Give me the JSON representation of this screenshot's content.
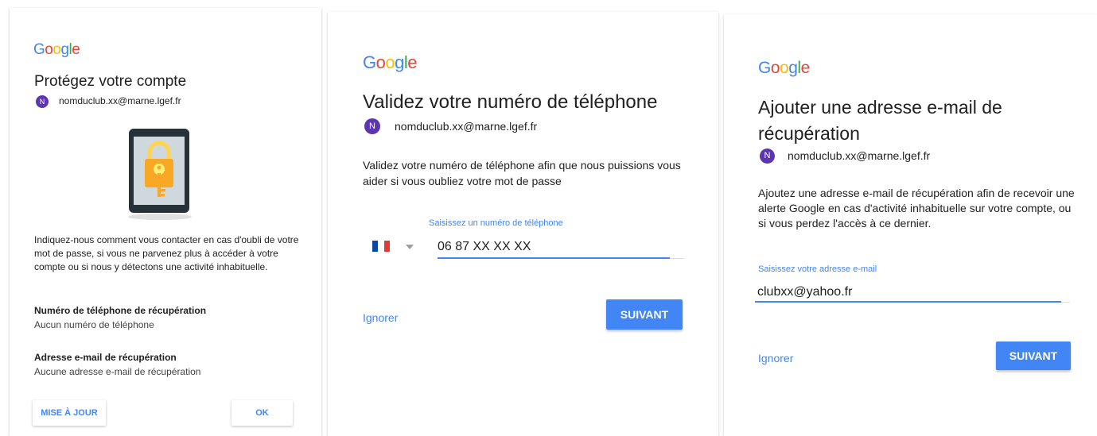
{
  "colors": {
    "accent": "#4285f4",
    "avatar": "#5e35b1"
  },
  "logo": [
    "G",
    "o",
    "o",
    "g",
    "l",
    "e"
  ],
  "panel1": {
    "title": "Protégez votre compte",
    "avatar_initial": "N",
    "email": "nomduclub.xx@marne.lgef.fr",
    "illustration": "phone-lock-key-icon",
    "description": "Indiquez-nous comment vous contacter en cas d'oubli de votre mot de passe, si vous ne parvenez plus à accéder à votre compte ou si nous y détectons une activité inhabituelle.",
    "phone_label": "Numéro de téléphone de récupération",
    "phone_value": "Aucun numéro de téléphone",
    "email_label": "Adresse e-mail de récupération",
    "email_value": "Aucune adresse e-mail de récupération",
    "update_button": "MISE À JOUR",
    "ok_button": "OK"
  },
  "panel2": {
    "title": "Validez votre numéro de téléphone",
    "avatar_initial": "N",
    "email": "nomduclub.xx@marne.lgef.fr",
    "description": "Validez votre numéro de téléphone afin que nous puissions vous aider si vous oubliez votre mot de passe",
    "country": "france-flag-icon",
    "field_label": "Saisissez un numéro de téléphone",
    "field_value": "06 87 XX XX XX",
    "skip_link": "Ignorer",
    "next_button": "SUIVANT"
  },
  "panel3": {
    "title_line1": "Ajouter une adresse e-mail de",
    "title_line2": "récupération",
    "avatar_initial": "N",
    "email": "nomduclub.xx@marne.lgef.fr",
    "description": "Ajoutez une adresse e-mail de récupération afin de recevoir une alerte Google en cas d'activité inhabituelle sur votre compte, ou si vous perdez l'accès à ce dernier.",
    "field_label": "Saisissez votre adresse e-mail",
    "field_value": "clubxx@yahoo.fr",
    "skip_link": "Ignorer",
    "next_button": "SUIVANT"
  }
}
